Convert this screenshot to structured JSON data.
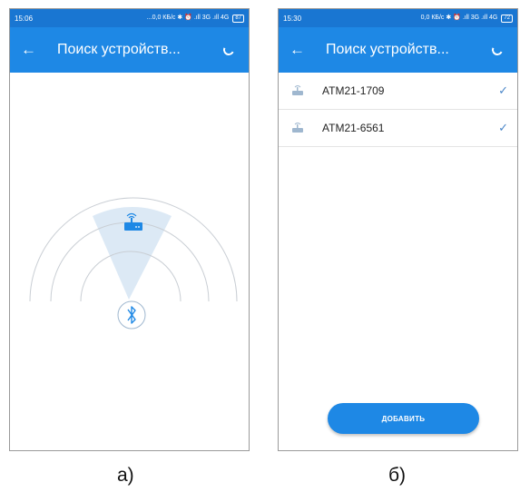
{
  "screen_a": {
    "status_time": "15:06",
    "status_right": "...0,0 КБ/с ✱ ⏰ .ıll 3G .ıll 4G",
    "battery": "87",
    "title": "Поиск устройств...",
    "back_icon": "arrow-left-icon"
  },
  "screen_b": {
    "status_time": "15:30",
    "status_right": "0,0 КБ/с ✱ ⏰ .ıll 3G .ıll 4G",
    "battery": "72",
    "title": "Поиск устройств...",
    "devices": [
      "ATM21-1709",
      "ATM21-6561"
    ],
    "add_button": "ДОБАВИТЬ"
  },
  "captions": {
    "a": "а)",
    "b": "б)"
  },
  "colors": {
    "primary": "#1e88e5",
    "statusbar": "#1976d2",
    "radar_fill": "#dce9f5",
    "arc": "#c9ced4"
  }
}
